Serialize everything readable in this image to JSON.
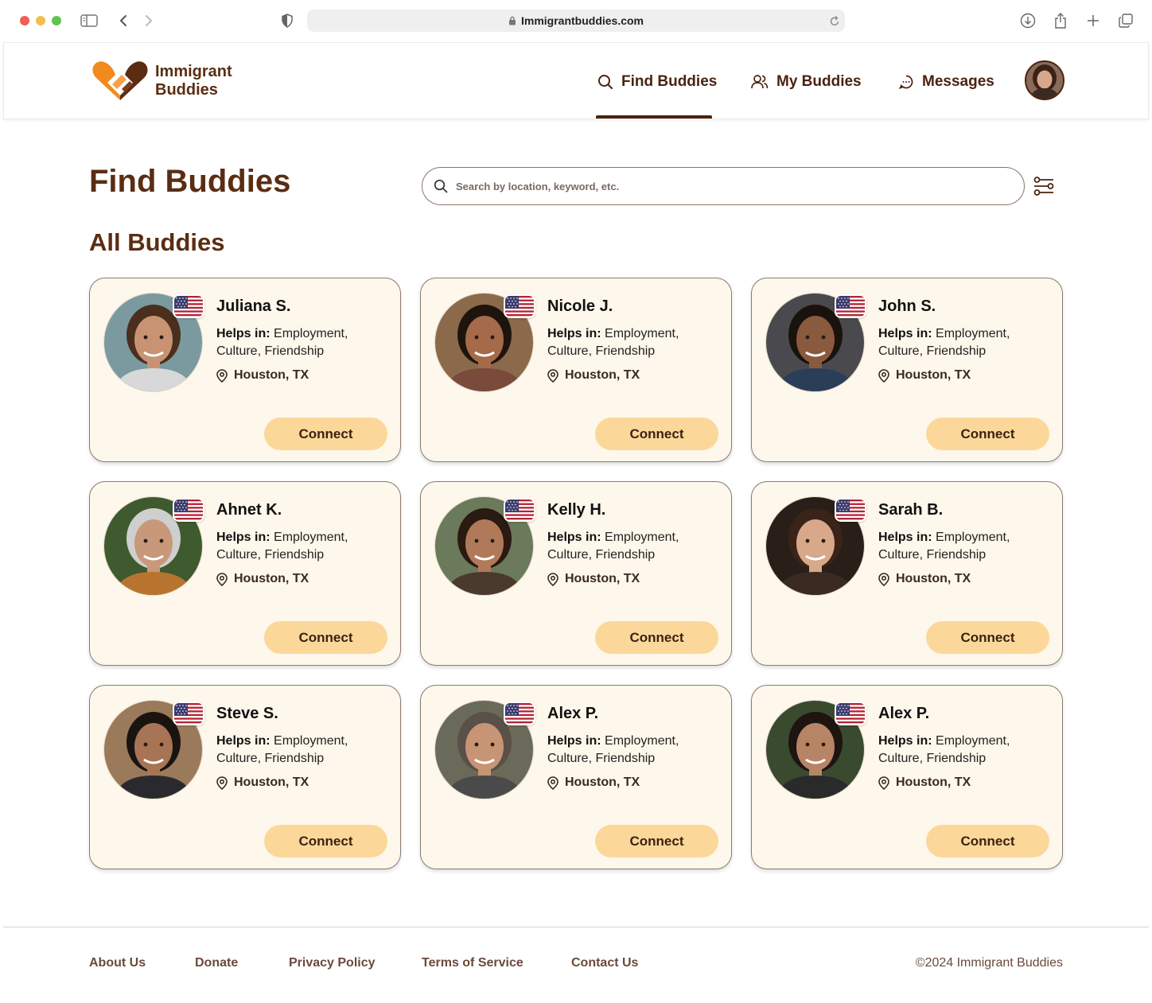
{
  "browser": {
    "url": "Immigrantbuddies.com"
  },
  "brand": {
    "line1": "Immigrant",
    "line2": "Buddies",
    "colors": {
      "primary": "#5a2d13",
      "accent": "#f28a1e",
      "button": "#fbd89a",
      "card": "#fef7eb"
    }
  },
  "nav": {
    "find": "Find Buddies",
    "my": "My Buddies",
    "messages": "Messages",
    "active": "Find Buddies"
  },
  "main": {
    "title": "Find Buddies",
    "search_placeholder": "Search by location, keyword, etc.",
    "section_title": "All Buddies"
  },
  "buddies": [
    {
      "name": "Juliana S.",
      "helps_label": "Helps in:",
      "helps": "Employment, Culture, Friendship",
      "location": "Houston, TX",
      "connect": "Connect",
      "flag": "us-flag-icon",
      "skin": "#c89373",
      "hair": "#4a2e1e",
      "bg": "#7a9aa0",
      "shirt": "#d8d8d8"
    },
    {
      "name": "Nicole J.",
      "helps_label": "Helps in:",
      "helps": "Employment, Culture, Friendship",
      "location": "Houston, TX",
      "connect": "Connect",
      "flag": "us-flag-icon",
      "skin": "#a46a4a",
      "hair": "#1e140e",
      "bg": "#8a6a4a",
      "shirt": "#7a4a3a"
    },
    {
      "name": "John S.",
      "helps_label": "Helps in:",
      "helps": "Employment, Culture, Friendship",
      "location": "Houston, TX",
      "connect": "Connect",
      "flag": "us-flag-icon",
      "skin": "#8a5a3e",
      "hair": "#1a120c",
      "bg": "#4a4a4e",
      "shirt": "#2a3e5a"
    },
    {
      "name": "Ahnet K.",
      "helps_label": "Helps in:",
      "helps": "Employment, Culture, Friendship",
      "location": "Houston, TX",
      "connect": "Connect",
      "flag": "us-flag-icon",
      "skin": "#c8987a",
      "hair": "#cfcfcf",
      "bg": "#3e5a2e",
      "shirt": "#b8742e"
    },
    {
      "name": "Kelly H.",
      "helps_label": "Helps in:",
      "helps": "Employment, Culture, Friendship",
      "location": "Houston, TX",
      "connect": "Connect",
      "flag": "us-flag-icon",
      "skin": "#b07a5a",
      "hair": "#2a1a12",
      "bg": "#6a7a5a",
      "shirt": "#4a3a2e"
    },
    {
      "name": "Sarah B.",
      "helps_label": "Helps in:",
      "helps": "Employment, Culture, Friendship",
      "location": "Houston, TX",
      "connect": "Connect",
      "flag": "us-flag-icon",
      "skin": "#d8a88a",
      "hair": "#3a2418",
      "bg": "#2a1e18",
      "shirt": "#3a2a22"
    },
    {
      "name": "Steve S.",
      "helps_label": "Helps in:",
      "helps": "Employment, Culture, Friendship",
      "location": "Houston, TX",
      "connect": "Connect",
      "flag": "us-flag-icon",
      "skin": "#a87456",
      "hair": "#1a1410",
      "bg": "#9a7a5a",
      "shirt": "#2a2a2e"
    },
    {
      "name": "Alex P.",
      "helps_label": "Helps in:",
      "helps": "Employment, Culture, Friendship",
      "location": "Houston, TX",
      "connect": "Connect",
      "flag": "us-flag-icon",
      "skin": "#c89476",
      "hair": "#5a5048",
      "bg": "#6a6a5a",
      "shirt": "#4a4a4a"
    },
    {
      "name": "Alex P.",
      "helps_label": "Helps in:",
      "helps": "Employment, Culture, Friendship",
      "location": "Houston, TX",
      "connect": "Connect",
      "flag": "us-flag-icon",
      "skin": "#b88466",
      "hair": "#1e1410",
      "bg": "#3a4a2e",
      "shirt": "#2a2a2a"
    }
  ],
  "footer": {
    "links": [
      "About Us",
      "Donate",
      "Privacy Policy",
      "Terms of Service",
      "Contact Us"
    ],
    "copyright": "©2024 Immigrant Buddies"
  }
}
